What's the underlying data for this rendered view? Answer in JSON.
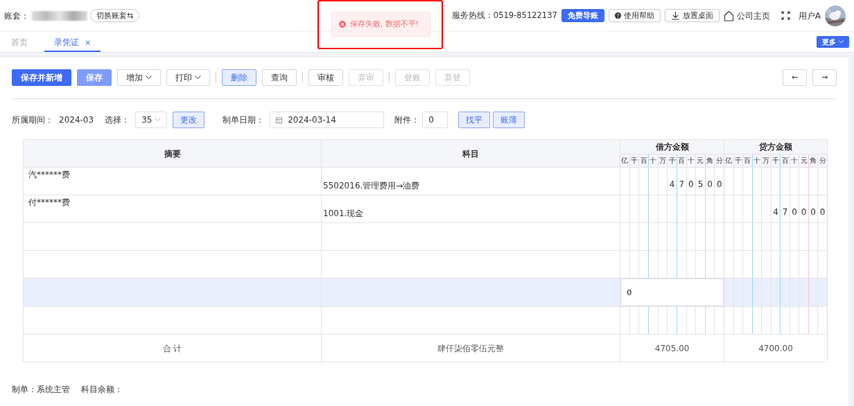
{
  "header": {
    "account_label": "账套：",
    "switch_button": "切换账套⇆",
    "toast": {
      "text": "保存失败, 数据不平!"
    },
    "hotline": "服务热线：0519-85122137",
    "import_button": "免费导账",
    "help_button": "使用帮助",
    "desktop_button": "放置桌面",
    "homepage_link": "公司主页",
    "user": "用户A"
  },
  "tabs": [
    {
      "label": "首页",
      "selected": false,
      "closable": false
    },
    {
      "label": "录凭证",
      "selected": true,
      "closable": true,
      "close": "×"
    }
  ],
  "more_button": "更多",
  "toolbar_groups": [
    [
      {
        "label": "保存并新增",
        "kind": "primary",
        "disabled": false,
        "dropdown": false
      },
      {
        "label": "保存",
        "kind": "primary-light",
        "disabled": false,
        "dropdown": false
      },
      {
        "label": "增加",
        "kind": "default",
        "disabled": false,
        "dropdown": true
      },
      {
        "label": "打印",
        "kind": "default",
        "disabled": false,
        "dropdown": true
      }
    ],
    [
      {
        "label": "删除",
        "kind": "soft",
        "disabled": false,
        "dropdown": false
      },
      {
        "label": "查询",
        "kind": "default",
        "disabled": false,
        "dropdown": false
      }
    ],
    [
      {
        "label": "审核",
        "kind": "default",
        "disabled": false,
        "dropdown": false
      },
      {
        "label": "弃审",
        "kind": "default",
        "disabled": true,
        "dropdown": false
      }
    ],
    [
      {
        "label": "登账",
        "kind": "default",
        "disabled": true,
        "dropdown": false
      },
      {
        "label": "弃登",
        "kind": "default",
        "disabled": true,
        "dropdown": false
      }
    ]
  ],
  "nav_buttons": [
    "←",
    "→"
  ],
  "form": {
    "period_label": "所属期间：",
    "period": "2024-03",
    "select_label": "选择：",
    "select_value": "35",
    "change_button": "更改",
    "date_label": "制单日期：",
    "date": "2024-03-14",
    "attach_label": "附件：",
    "attach": "0",
    "balance_button": "找平",
    "ledger_button": "账薄"
  },
  "voucher": {
    "columns": [
      "摘要",
      "科目",
      "借方金额",
      "贷方金额"
    ],
    "debit_units": [
      "亿",
      "千",
      "百",
      "十",
      "万",
      "千",
      "百",
      "十",
      "元",
      "角",
      "分"
    ],
    "credit_units": [
      "亿",
      "千",
      "百",
      "十",
      "万",
      "千",
      "百",
      "十",
      "元",
      "角",
      "分"
    ],
    "rows": [
      {
        "summary": "汽******费",
        "subject": "5502016.管理费用→油费",
        "debit_digits": [
          "4",
          "7",
          "0",
          "5",
          "0",
          "0"
        ],
        "credit_digits": [],
        "selected": false
      },
      {
        "summary": "付******费",
        "subject": "1001.现金",
        "debit_digits": [],
        "credit_digits": [
          "4",
          "7",
          "0",
          "0",
          "0",
          "0"
        ],
        "selected": false
      },
      {
        "summary": "",
        "subject": "",
        "debit_digits": [],
        "credit_digits": [],
        "selected": false
      },
      {
        "summary": "",
        "subject": "",
        "debit_digits": [],
        "credit_digits": [],
        "selected": false
      },
      {
        "summary": "",
        "subject": "",
        "debit_digits": [],
        "credit_digits": [],
        "selected": true,
        "debit_input": "0"
      },
      {
        "summary": "",
        "subject": "",
        "debit_digits": [],
        "credit_digits": [],
        "selected": false
      }
    ],
    "total": {
      "label": "合 计",
      "amount_words": "肆仟柒佰零伍元整",
      "debit": "4705.00",
      "credit": "4700.00"
    }
  },
  "footer": {
    "maker": "制单：系统主管",
    "balance": "科目余额："
  }
}
